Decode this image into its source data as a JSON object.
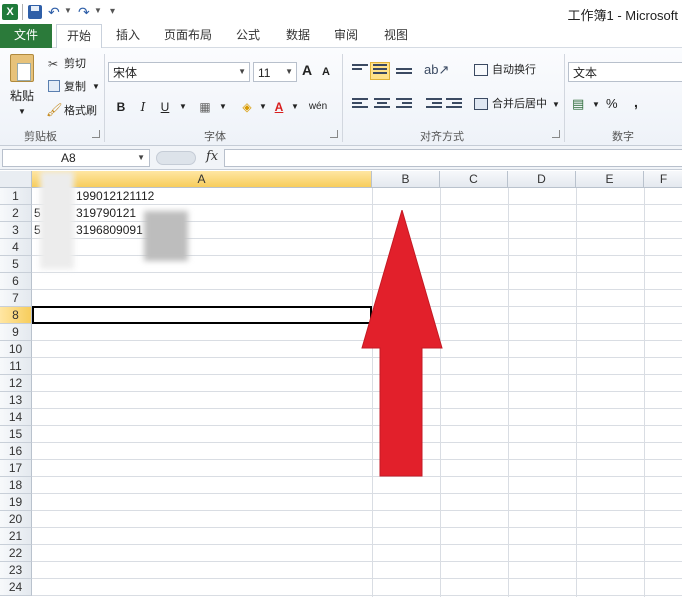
{
  "window": {
    "app_logo": "X",
    "title": "工作簿1 - Microsoft"
  },
  "tabs": [
    {
      "label": "文件"
    },
    {
      "label": "开始"
    },
    {
      "label": "插入"
    },
    {
      "label": "页面布局"
    },
    {
      "label": "公式"
    },
    {
      "label": "数据"
    },
    {
      "label": "审阅"
    },
    {
      "label": "视图"
    }
  ],
  "ribbon": {
    "clipboard": {
      "paste": "粘贴",
      "cut": "剪切",
      "copy": "复制",
      "format_painter": "格式刷",
      "group": "剪贴板"
    },
    "font": {
      "name": "宋体",
      "size": "11",
      "grow": "A",
      "shrink": "A",
      "bold": "B",
      "italic": "I",
      "underline": "U",
      "font_color": "A",
      "phonetic": "wén",
      "group": "字体"
    },
    "alignment": {
      "wrap_text": "自动换行",
      "merge_center": "合并后居中",
      "group": "对齐方式"
    },
    "number": {
      "format": "文本",
      "percent": "%",
      "comma": ",",
      "group": "数字"
    }
  },
  "formula_bar": {
    "name_box": "A8",
    "fx": "fx",
    "value": ""
  },
  "sheet": {
    "columns": [
      "A",
      "B",
      "C",
      "D",
      "E",
      "F"
    ],
    "rows": [
      "1",
      "2",
      "3",
      "4",
      "5",
      "6",
      "7",
      "8",
      "9",
      "10",
      "11",
      "12",
      "13",
      "14",
      "15",
      "16",
      "17",
      "18",
      "19",
      "20",
      "21",
      "22",
      "23",
      "24"
    ],
    "selected_cell": "A8",
    "cells": {
      "A1": "199012121112",
      "A2": "319790121",
      "A3": "3196809091",
      "A2_prefix": "5",
      "A3_prefix": "5"
    }
  },
  "colors": {
    "accent_red": "#e2202b",
    "file_tab": "#2b7a3a",
    "selected_header": "#f7cd5c"
  }
}
